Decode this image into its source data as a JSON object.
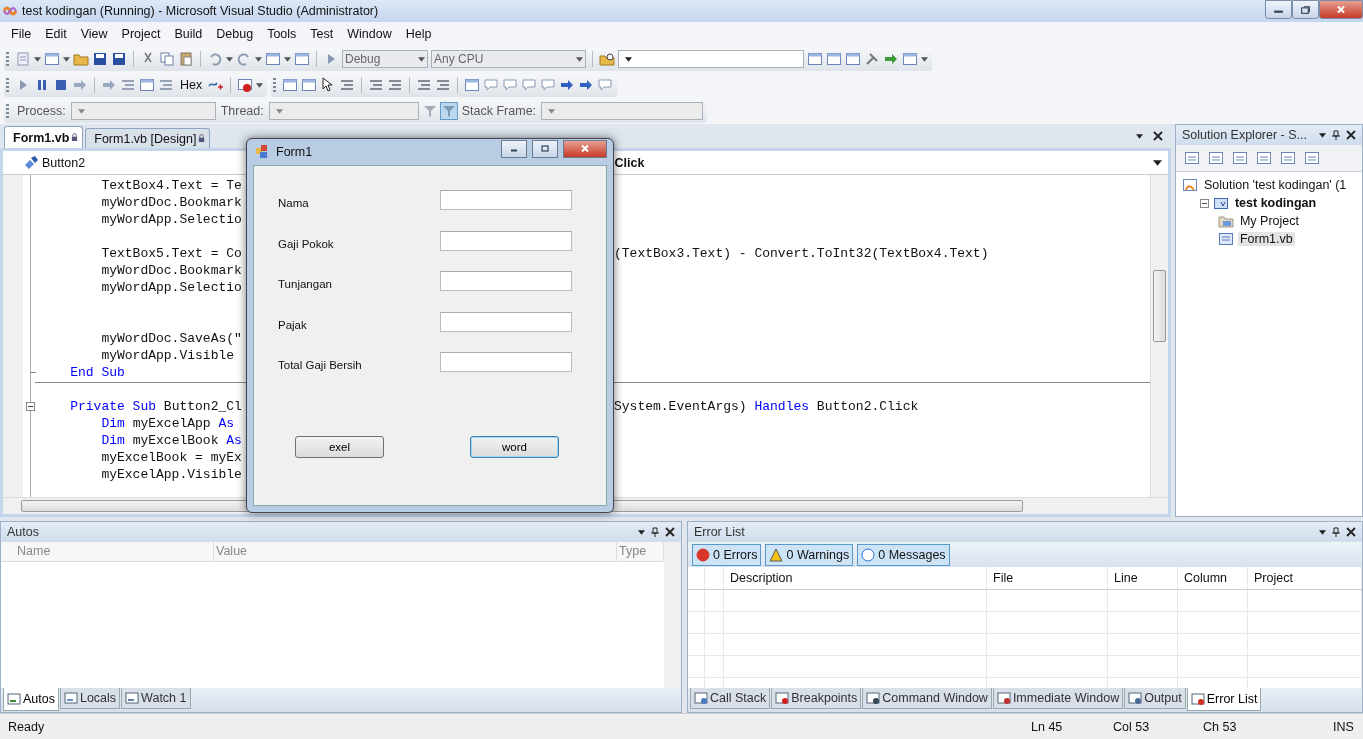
{
  "window": {
    "title": "test kodingan (Running) - Microsoft Visual Studio (Administrator)"
  },
  "menu": [
    "File",
    "Edit",
    "View",
    "Project",
    "Build",
    "Debug",
    "Tools",
    "Test",
    "Window",
    "Help"
  ],
  "toolbar": {
    "configuration": "Debug",
    "platform": "Any CPU",
    "hex_label": "Hex"
  },
  "debug_location": {
    "process_label": "Process:",
    "thread_label": "Thread:",
    "stack_frame_label": "Stack Frame:"
  },
  "document_tabs": [
    {
      "label": "Form1.vb",
      "selected": true
    },
    {
      "label": "Form1.vb [Design]",
      "selected": false
    }
  ],
  "editor": {
    "object_dropdown": "Button2",
    "event_dropdown": "Click",
    "lines": [
      {
        "left": [
          {
            "kind": "plain",
            "text": "        TextBox4.Text = Te"
          }
        ]
      },
      {
        "left": [
          {
            "kind": "plain",
            "text": "        myWordDoc.Bookmark"
          }
        ]
      },
      {
        "left": [
          {
            "kind": "plain",
            "text": "        myWordApp.Selectio"
          }
        ]
      },
      {
        "kind": "blank"
      },
      {
        "left": [
          {
            "kind": "plain",
            "text": "        TextBox5.Text = Co"
          }
        ],
        "right": [
          {
            "kind": "plain",
            "text": "(TextBox3.Text) - Convert.ToInt32(TextBox4.Text)"
          }
        ]
      },
      {
        "left": [
          {
            "kind": "plain",
            "text": "        myWordDoc.Bookmark"
          }
        ]
      },
      {
        "left": [
          {
            "kind": "plain",
            "text": "        myWordApp.Selectio"
          }
        ]
      },
      {
        "kind": "blank"
      },
      {
        "kind": "blank"
      },
      {
        "left": [
          {
            "kind": "plain",
            "text": "        myWordDoc.SaveAs(\""
          }
        ]
      },
      {
        "left": [
          {
            "kind": "plain",
            "text": "        myWordApp.Visible"
          }
        ]
      },
      {
        "left": [
          {
            "kind": "keyword",
            "text": "    End Sub"
          }
        ],
        "block_end": true,
        "separator": true
      },
      {
        "kind": "blank"
      },
      {
        "left": [
          {
            "kind": "keyword",
            "text": "    Private Sub "
          },
          {
            "kind": "plain",
            "text": "Button2_Cl"
          }
        ],
        "right": [
          {
            "kind": "plain",
            "text": "System.EventArgs) "
          },
          {
            "kind": "keyword",
            "text": "Handles"
          },
          {
            "kind": "plain",
            "text": " Button2.Click"
          }
        ],
        "collapsible": true
      },
      {
        "left": [
          {
            "kind": "keyword",
            "text": "        Dim "
          },
          {
            "kind": "plain",
            "text": "myExcelApp "
          },
          {
            "kind": "keyword",
            "text": "As"
          }
        ]
      },
      {
        "left": [
          {
            "kind": "keyword",
            "text": "        Dim "
          },
          {
            "kind": "plain",
            "text": "myExcelBook "
          },
          {
            "kind": "keyword",
            "text": "As"
          }
        ]
      },
      {
        "left": [
          {
            "kind": "plain",
            "text": "        myExcelBook = myEx"
          }
        ]
      },
      {
        "left": [
          {
            "kind": "plain",
            "text": "        myExcelApp.Visible"
          }
        ]
      }
    ]
  },
  "form_window": {
    "title": "Form1",
    "fields": [
      {
        "label": "Nama"
      },
      {
        "label": "Gaji Pokok"
      },
      {
        "label": "Tunjangan"
      },
      {
        "label": "Pajak"
      },
      {
        "label": "Total Gaji Bersih"
      }
    ],
    "buttons": [
      {
        "label": "exel",
        "focused": false
      },
      {
        "label": "word",
        "focused": true
      }
    ]
  },
  "solution_explorer": {
    "title": "Solution Explorer - S...",
    "tree": [
      {
        "label": "Solution 'test kodingan' (1",
        "kind": "solution",
        "startup": false,
        "selected": false,
        "children": [
          {
            "label": "test kodingan",
            "kind": "project",
            "startup": true,
            "selected": false,
            "children": [
              {
                "label": "My Project",
                "kind": "properties",
                "startup": false,
                "selected": false
              },
              {
                "label": "Form1.vb",
                "kind": "form",
                "startup": false,
                "selected": true
              }
            ]
          }
        ]
      }
    ]
  },
  "autos": {
    "title": "Autos",
    "columns": [
      "Name",
      "Value",
      "Type"
    ],
    "tabs": [
      {
        "label": "Autos",
        "kind": "autos",
        "selected": true
      },
      {
        "label": "Locals",
        "kind": "locals",
        "selected": false
      },
      {
        "label": "Watch 1",
        "kind": "watch",
        "selected": false
      }
    ]
  },
  "error_list": {
    "title": "Error List",
    "filters": [
      {
        "label": "0 Errors",
        "kind": "error"
      },
      {
        "label": "0 Warnings",
        "kind": "warning"
      },
      {
        "label": "0 Messages",
        "kind": "message"
      }
    ],
    "columns": [
      "Description",
      "File",
      "Line",
      "Column",
      "Project"
    ],
    "tabs": [
      {
        "label": "Call Stack",
        "kind": "callstack",
        "selected": false
      },
      {
        "label": "Breakpoints",
        "kind": "breakpoints",
        "selected": false
      },
      {
        "label": "Command Window",
        "kind": "command",
        "selected": false
      },
      {
        "label": "Immediate Window",
        "kind": "immediate",
        "selected": false
      },
      {
        "label": "Output",
        "kind": "output",
        "selected": false
      },
      {
        "label": "Error List",
        "kind": "errorlist",
        "selected": true
      }
    ]
  },
  "status_bar": {
    "message": "Ready",
    "ln": "Ln 45",
    "col": "Col 53",
    "ch": "Ch 53",
    "mode": "INS"
  }
}
